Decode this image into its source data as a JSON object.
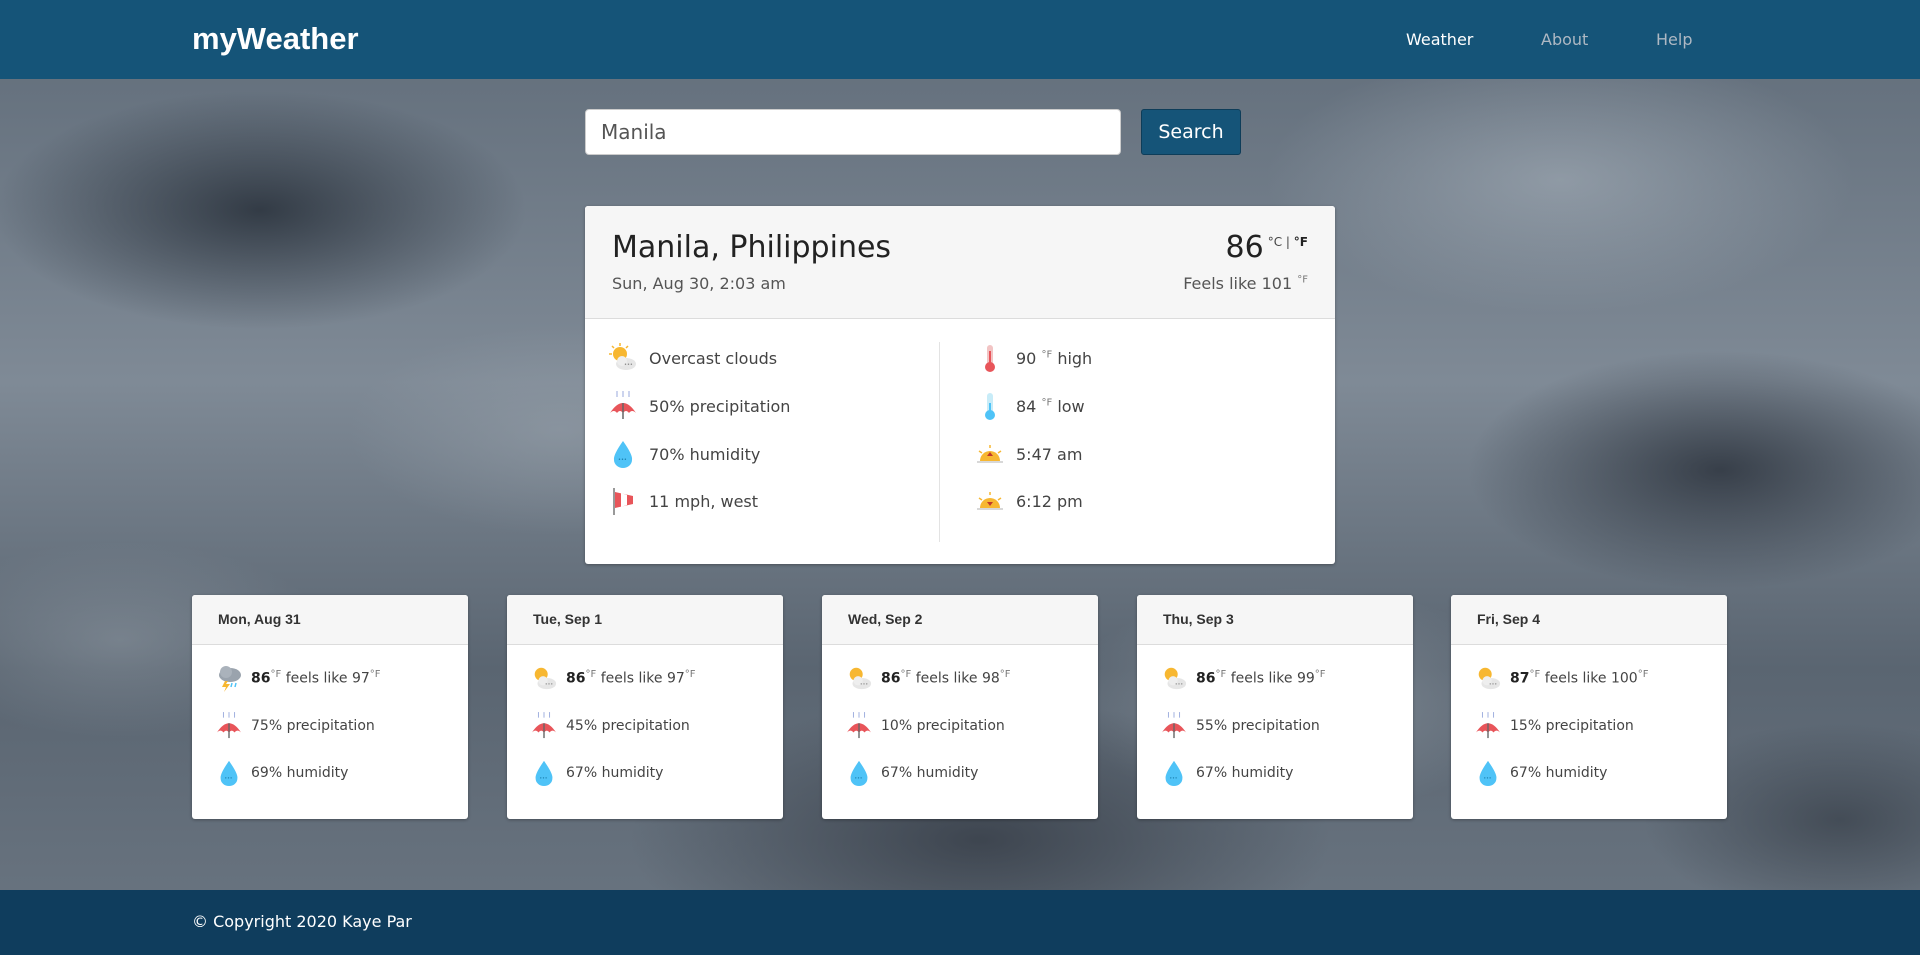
{
  "header": {
    "brand": "myWeather",
    "nav": [
      "Weather",
      "About",
      "Help"
    ]
  },
  "search": {
    "value": "Manila",
    "placeholder": "",
    "button_label": "Search"
  },
  "current": {
    "location": "Manila, Philippines",
    "datetime": "Sun, Aug 30, 2:03 am",
    "temp": "86",
    "unit_c": "°C",
    "unit_sep": "|",
    "unit_f": "°F",
    "feels_label": "Feels like",
    "feels_value": "101",
    "feels_unit": "°F",
    "left": [
      {
        "icon": "partly-cloudy-icon",
        "text": "Overcast clouds"
      },
      {
        "icon": "umbrella-icon",
        "text": "50% precipitation"
      },
      {
        "icon": "humidity-drop-icon",
        "text": "70% humidity"
      },
      {
        "icon": "wind-flag-icon",
        "text": "11 mph, west"
      }
    ],
    "right": [
      {
        "icon": "thermometer-hot-icon",
        "value": "90",
        "unit": "°F",
        "label": "high"
      },
      {
        "icon": "thermometer-cold-icon",
        "value": "84",
        "unit": "°F",
        "label": "low"
      },
      {
        "icon": "sunrise-icon",
        "text": "5:47 am"
      },
      {
        "icon": "sunset-icon",
        "text": "6:12 pm"
      }
    ]
  },
  "forecast": [
    {
      "day": "Mon, Aug 31",
      "icon": "thunderstorm-icon",
      "temp": "86",
      "unit": "°F",
      "feels_label": "feels like",
      "feels": "97",
      "precip": "75% precipitation",
      "humidity": "69% humidity"
    },
    {
      "day": "Tue, Sep 1",
      "icon": "partly-cloudy-icon",
      "temp": "86",
      "unit": "°F",
      "feels_label": "feels like",
      "feels": "97",
      "precip": "45% precipitation",
      "humidity": "67% humidity"
    },
    {
      "day": "Wed, Sep 2",
      "icon": "partly-cloudy-icon",
      "temp": "86",
      "unit": "°F",
      "feels_label": "feels like",
      "feels": "98",
      "precip": "10% precipitation",
      "humidity": "67% humidity"
    },
    {
      "day": "Thu, Sep 3",
      "icon": "partly-cloudy-icon",
      "temp": "86",
      "unit": "°F",
      "feels_label": "feels like",
      "feels": "99",
      "precip": "55% precipitation",
      "humidity": "67% humidity"
    },
    {
      "day": "Fri, Sep 4",
      "icon": "partly-cloudy-icon",
      "temp": "87",
      "unit": "°F",
      "feels_label": "feels like",
      "feels": "100",
      "precip": "15% precipitation",
      "humidity": "67% humidity"
    }
  ],
  "footer": {
    "text": "© Copyright 2020 Kaye Par"
  },
  "colors": {
    "header": "#155478",
    "footer": "#0f3d5d",
    "card_head": "#f6f6f6",
    "umbrella": "#e8555a",
    "drop": "#4fc3f7",
    "sun": "#f7b731"
  }
}
